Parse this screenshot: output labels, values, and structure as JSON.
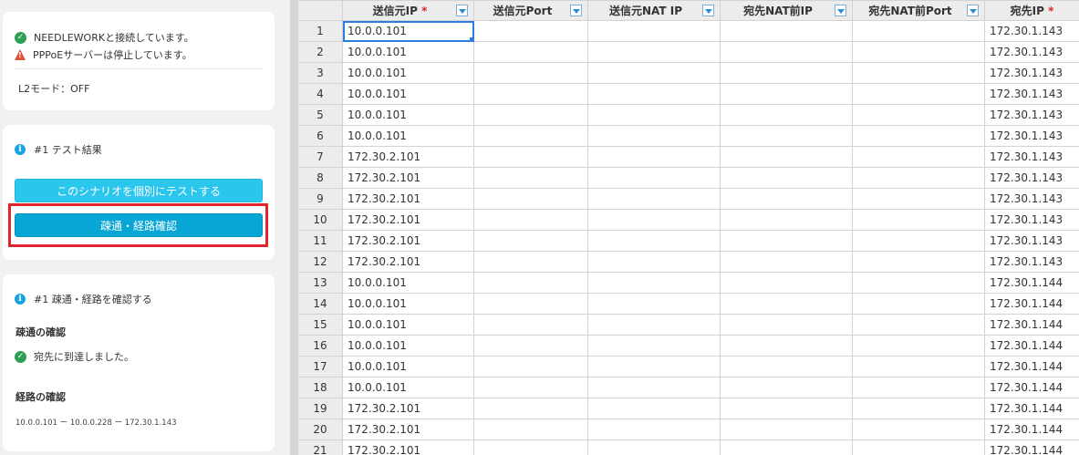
{
  "status": {
    "connected": "NEEDLEWORKと接続しています。",
    "pppoe": "PPPoEサーバーは停止しています。",
    "l2mode": "L2モード：OFF"
  },
  "test": {
    "title": "#1 テスト結果",
    "button_individual": "このシナリオを個別にテストする",
    "button_route": "疎通・経路確認"
  },
  "check": {
    "title": "#1 疎通・経路を確認する",
    "reach_heading": "疎通の確認",
    "reach_result": "宛先に到達しました。",
    "route_heading": "経路の確認",
    "route_path": "10.0.0.101 ー 10.0.0.228 ー 172.30.1.143"
  },
  "grid": {
    "columns": [
      {
        "label": "送信元IP",
        "required": "*"
      },
      {
        "label": "送信元Port",
        "required": ""
      },
      {
        "label": "送信元NAT IP",
        "required": ""
      },
      {
        "label": "宛先NAT前IP",
        "required": ""
      },
      {
        "label": "宛先NAT前Port",
        "required": ""
      },
      {
        "label": "宛先IP",
        "required": "*"
      }
    ],
    "rows": [
      {
        "num": "1",
        "src": "10.0.0.101",
        "dst": "172.30.1.143"
      },
      {
        "num": "2",
        "src": "10.0.0.101",
        "dst": "172.30.1.143"
      },
      {
        "num": "3",
        "src": "10.0.0.101",
        "dst": "172.30.1.143"
      },
      {
        "num": "4",
        "src": "10.0.0.101",
        "dst": "172.30.1.143"
      },
      {
        "num": "5",
        "src": "10.0.0.101",
        "dst": "172.30.1.143"
      },
      {
        "num": "6",
        "src": "10.0.0.101",
        "dst": "172.30.1.143"
      },
      {
        "num": "7",
        "src": "172.30.2.101",
        "dst": "172.30.1.143"
      },
      {
        "num": "8",
        "src": "172.30.2.101",
        "dst": "172.30.1.143"
      },
      {
        "num": "9",
        "src": "172.30.2.101",
        "dst": "172.30.1.143"
      },
      {
        "num": "10",
        "src": "172.30.2.101",
        "dst": "172.30.1.143"
      },
      {
        "num": "11",
        "src": "172.30.2.101",
        "dst": "172.30.1.143"
      },
      {
        "num": "12",
        "src": "172.30.2.101",
        "dst": "172.30.1.143"
      },
      {
        "num": "13",
        "src": "10.0.0.101",
        "dst": "172.30.1.144"
      },
      {
        "num": "14",
        "src": "10.0.0.101",
        "dst": "172.30.1.144"
      },
      {
        "num": "15",
        "src": "10.0.0.101",
        "dst": "172.30.1.144"
      },
      {
        "num": "16",
        "src": "10.0.0.101",
        "dst": "172.30.1.144"
      },
      {
        "num": "17",
        "src": "10.0.0.101",
        "dst": "172.30.1.144"
      },
      {
        "num": "18",
        "src": "10.0.0.101",
        "dst": "172.30.1.144"
      },
      {
        "num": "19",
        "src": "172.30.2.101",
        "dst": "172.30.1.144"
      },
      {
        "num": "20",
        "src": "172.30.2.101",
        "dst": "172.30.1.144"
      },
      {
        "num": "21",
        "src": "172.30.2.101",
        "dst": "172.30.1.144"
      }
    ]
  },
  "colors": {
    "accent": "#08a6d5",
    "accent_light": "#2bc6ec",
    "highlight": "#e3232c",
    "ok": "#2e9e55",
    "warn": "#e0533b",
    "info": "#1aa3e0"
  }
}
